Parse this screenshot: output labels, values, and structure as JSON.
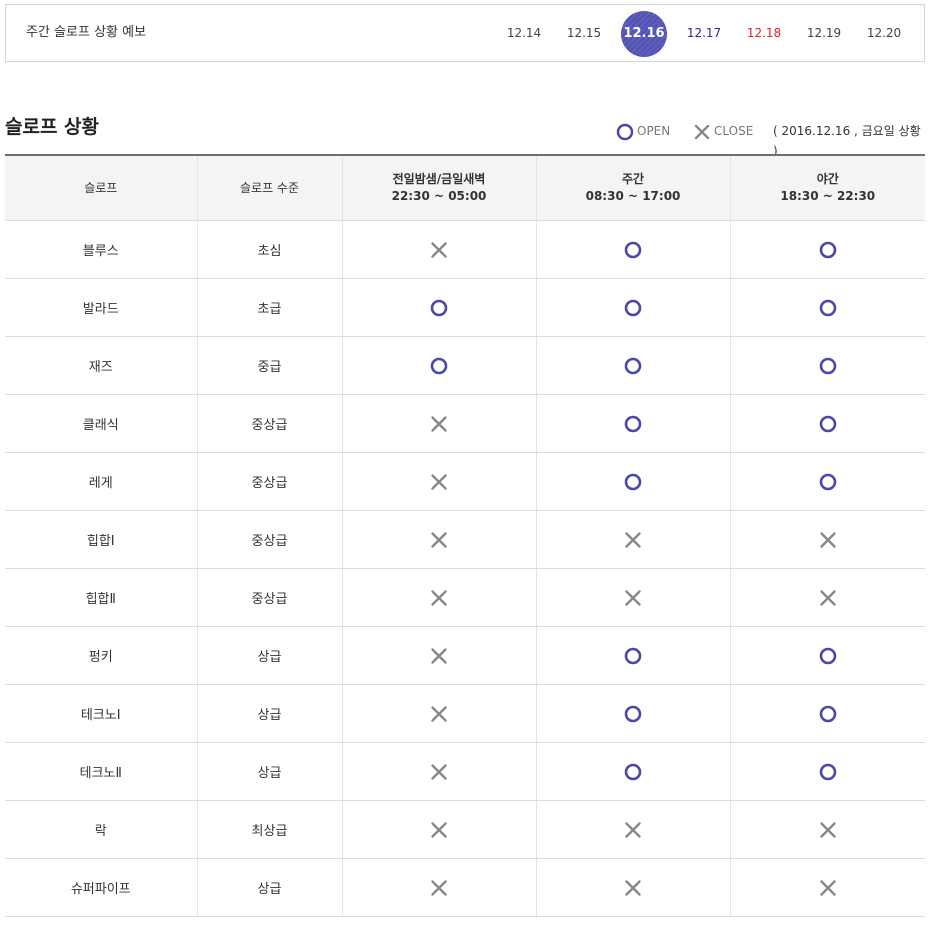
{
  "forecast": {
    "title": "주간 슬로프 상황 예보",
    "dates": [
      {
        "label": "12.14",
        "type": "weekday"
      },
      {
        "label": "12.15",
        "type": "weekday"
      },
      {
        "label": "12.16",
        "type": "active"
      },
      {
        "label": "12.17",
        "type": "sat"
      },
      {
        "label": "12.18",
        "type": "sun"
      },
      {
        "label": "12.19",
        "type": "weekday"
      },
      {
        "label": "12.20",
        "type": "weekday"
      }
    ]
  },
  "section": {
    "title": "슬로프 상황",
    "legend_open": "OPEN",
    "legend_close": "CLOSE",
    "date_note": "( 2016.12.16 , 금요일 상황 )"
  },
  "colors": {
    "open": "#4a48a8",
    "close": "#888888",
    "active_date": "#5152b4",
    "saturday": "#2a2aa8",
    "sunday": "#e0242a"
  },
  "table": {
    "headers": [
      {
        "label": "슬로프",
        "sub": ""
      },
      {
        "label": "슬로프 수준",
        "sub": ""
      },
      {
        "label": "전일밤샘/금일새벽",
        "sub": "22:30 ~ 05:00"
      },
      {
        "label": "주간",
        "sub": "08:30 ~ 17:00"
      },
      {
        "label": "야간",
        "sub": "18:30 ~ 22:30"
      }
    ],
    "rows": [
      {
        "slope": "블루스",
        "level": "초심",
        "status": [
          "close",
          "open",
          "open"
        ]
      },
      {
        "slope": "발라드",
        "level": "초급",
        "status": [
          "open",
          "open",
          "open"
        ]
      },
      {
        "slope": "재즈",
        "level": "중급",
        "status": [
          "open",
          "open",
          "open"
        ]
      },
      {
        "slope": "클래식",
        "level": "중상급",
        "status": [
          "close",
          "open",
          "open"
        ]
      },
      {
        "slope": "레게",
        "level": "중상급",
        "status": [
          "close",
          "open",
          "open"
        ]
      },
      {
        "slope": "힙합Ⅰ",
        "level": "중상급",
        "status": [
          "close",
          "close",
          "close"
        ]
      },
      {
        "slope": "힙합Ⅱ",
        "level": "중상급",
        "status": [
          "close",
          "close",
          "close"
        ]
      },
      {
        "slope": "펑키",
        "level": "상급",
        "status": [
          "close",
          "open",
          "open"
        ]
      },
      {
        "slope": "테크노Ⅰ",
        "level": "상급",
        "status": [
          "close",
          "open",
          "open"
        ]
      },
      {
        "slope": "테크노Ⅱ",
        "level": "상급",
        "status": [
          "close",
          "open",
          "open"
        ]
      },
      {
        "slope": "락",
        "level": "최상급",
        "status": [
          "close",
          "close",
          "close"
        ]
      },
      {
        "slope": "슈퍼파이프",
        "level": "상급",
        "status": [
          "close",
          "close",
          "close"
        ]
      }
    ]
  }
}
